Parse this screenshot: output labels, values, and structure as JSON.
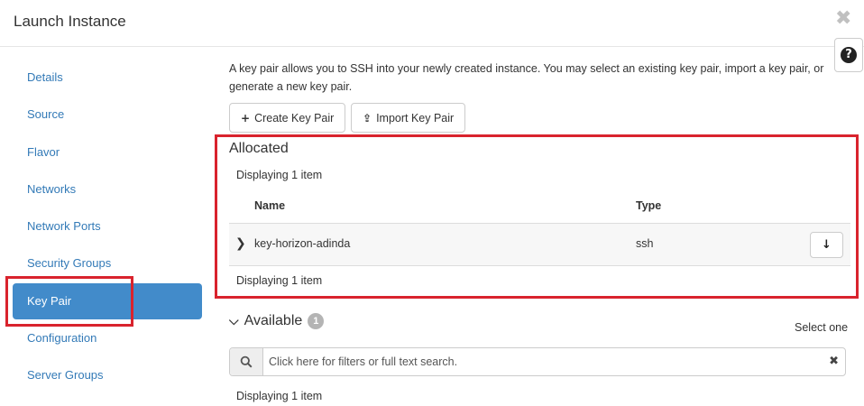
{
  "modal": {
    "title": "Launch Instance",
    "close_glyph": "✖",
    "help_glyph": "?"
  },
  "sidebar": {
    "items": [
      {
        "label": "Details"
      },
      {
        "label": "Source"
      },
      {
        "label": "Flavor"
      },
      {
        "label": "Networks"
      },
      {
        "label": "Network Ports"
      },
      {
        "label": "Security Groups"
      },
      {
        "label": "Key Pair",
        "active": true
      },
      {
        "label": "Configuration"
      },
      {
        "label": "Server Groups"
      }
    ]
  },
  "main": {
    "description": "A key pair allows you to SSH into your newly created instance. You may select an existing key pair, import a key pair, or generate a new key pair.",
    "buttons": {
      "create_label": "Create Key Pair",
      "create_icon": "+",
      "import_label": "Import Key Pair",
      "import_icon": "⇪"
    },
    "allocated": {
      "title": "Allocated",
      "display_top": "Displaying 1 item",
      "display_bottom": "Displaying 1 item",
      "columns": [
        "Name",
        "Type"
      ],
      "rows": [
        {
          "name": "key-horizon-adinda",
          "type": "ssh"
        }
      ]
    },
    "available": {
      "title": "Available",
      "count": "1",
      "select_one": "Select one",
      "search_placeholder": "Click here for filters or full text search.",
      "display": "Displaying 1 item"
    }
  },
  "colors": {
    "accent": "#428bca",
    "link": "#337ab7",
    "highlight_border": "#d9232d",
    "badge": "#b4b4b4"
  }
}
